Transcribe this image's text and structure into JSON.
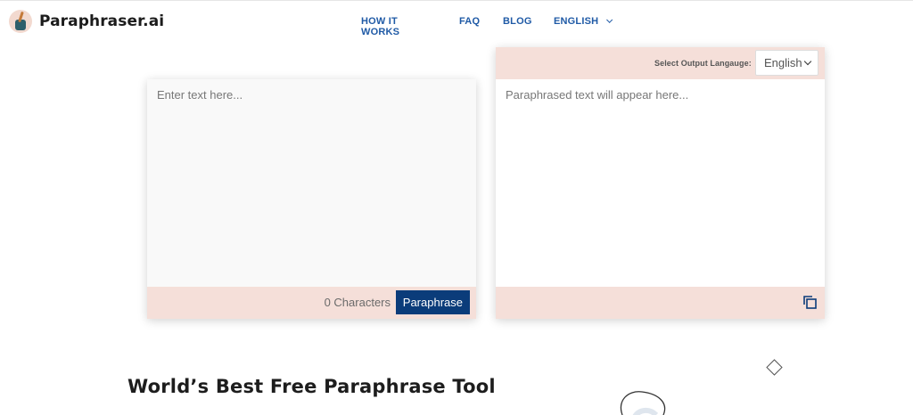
{
  "brand": {
    "name": "Paraphraser.ai",
    "logo_icon": "inkpot-quill-icon"
  },
  "nav": {
    "items": [
      {
        "label": "HOW IT WORKS"
      },
      {
        "label": "FAQ"
      },
      {
        "label": "BLOG"
      },
      {
        "label": "ENGLISH"
      }
    ]
  },
  "input_panel": {
    "placeholder": "Enter text here...",
    "value": "",
    "char_count": "0 Characters",
    "button_label": "Paraphrase"
  },
  "output_panel": {
    "language_label": "Select Output Langauge:",
    "language_selected": "English",
    "placeholder": "Paraphrased text will appear here...",
    "copy_icon": "copy-icon"
  },
  "main": {
    "headline": "World’s Best Free Paraphrase Tool"
  },
  "colors": {
    "accent": "#0b3c7a",
    "nav_link": "#1f5aa6",
    "panel_band": "#f5dfd9"
  }
}
